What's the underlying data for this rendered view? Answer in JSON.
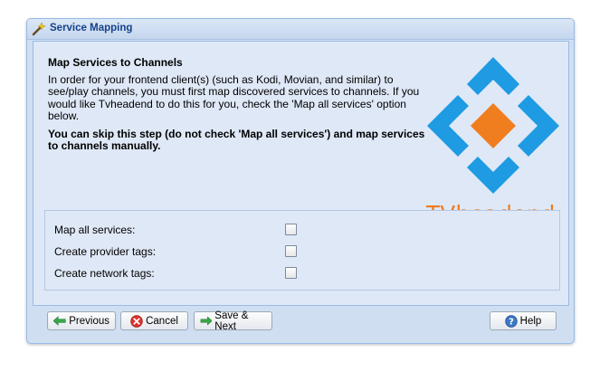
{
  "window": {
    "title": "Service Mapping"
  },
  "intro": {
    "heading": "Map Services to Channels",
    "body": "In order for your frontend client(s) (such as Kodi, Movian, and similar) to see/play channels, you must first map discovered services to channels. If you would like Tvheadend to do this for you, check the 'Map all services' option below.",
    "note": "You can skip this step (do not check 'Map all services') and map services to channels manually."
  },
  "logo": {
    "text": "TVheadend",
    "blue": "#1e9be3",
    "orange": "#f07d1e"
  },
  "options": [
    {
      "label": "Map all services:",
      "checked": false
    },
    {
      "label": "Create provider tags:",
      "checked": false
    },
    {
      "label": "Create network tags:",
      "checked": false
    }
  ],
  "buttons": {
    "previous": "Previous",
    "cancel": "Cancel",
    "save_next": "Save & Next",
    "help": "Help"
  }
}
